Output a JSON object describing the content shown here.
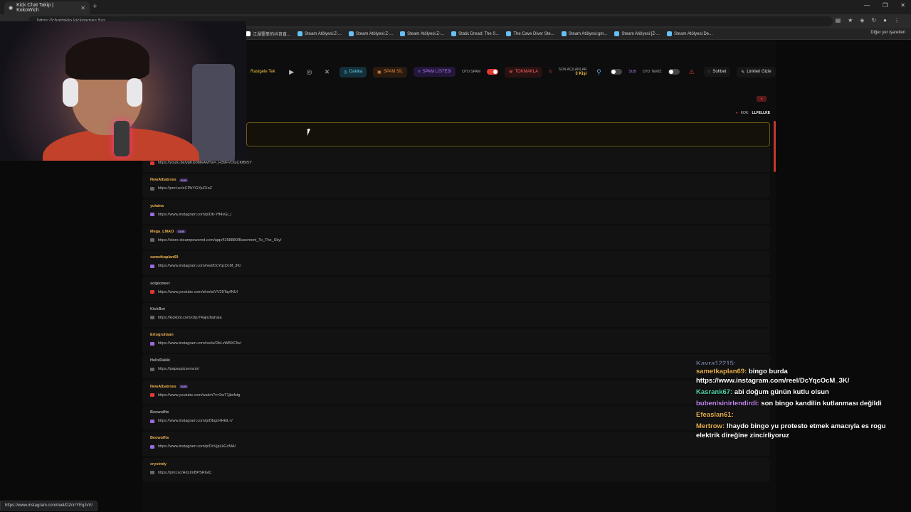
{
  "browser": {
    "tab_title": "Kick Chat Takip | KokoWich",
    "url": "https://chattakip.kickgames.fun",
    "bookmarks": [
      {
        "label": "江湖霊拳的抖音直...",
        "color": "#fff"
      },
      {
        "label": "Steam Atölyesi:Z-...",
        "color": "#66c0f4"
      },
      {
        "label": "Steam Atölyesi:Z-...",
        "color": "#66c0f4"
      },
      {
        "label": "Steam Atölyesi:Z-...",
        "color": "#66c0f4"
      },
      {
        "label": "Static Dread: The S...",
        "color": "#66c0f4"
      },
      {
        "label": "The Cave Diver Ste...",
        "color": "#66c0f4"
      },
      {
        "label": "Steam Atölyesi:gm...",
        "color": "#66c0f4"
      },
      {
        "label": "Steam Atölyesi:[Z-...",
        "color": "#66c0f4"
      },
      {
        "label": "Steam Atölyesi:De...",
        "color": "#66c0f4"
      }
    ],
    "all_bookmarks": "Diğer yer işaretleri",
    "status_url": "https://www.instagram.com/reel/DZcrrYEqJvV/"
  },
  "toolbar": {
    "random": "Rastgele Tek",
    "duration": "Dakika",
    "spam_delete": "SPAM SİL",
    "spam_list": "SPAM LİSTESİ",
    "auto_spam": "OTO SPAM",
    "hammer": "TOKMAKLA",
    "last_opened_label": "SON AÇILANLAR",
    "last_opened_count": "3 Kişi",
    "sub": "SUB",
    "otoclear": "OTO TEMİZ",
    "chat": "Sohbet",
    "hide_links": "Linkleri Gizle"
  },
  "filter": {
    "prefix": "KOK:",
    "user": "LLFELLKE"
  },
  "items": [
    {
      "user": "",
      "sub": false,
      "link": "https://youtu.be/ypKD0MeAM?si=_H39FVOGCKfBr5Y",
      "color": "#e8b050",
      "icon": "youtube"
    },
    {
      "user": "NewAlbatross",
      "sub": true,
      "link": "https://prnt.sc/eCPbYGYpZXoZ",
      "color": "#e8b050",
      "icon": "link"
    },
    {
      "user": "yulaina",
      "sub": false,
      "link": "https://www.instagram.com/p/Db-Yff4xGi_/",
      "color": "#e8b050",
      "icon": "instagram"
    },
    {
      "user": "Mega_LMAO",
      "sub": true,
      "link": "https://store.steampowered.com/app/4258880/Basement_To_The_Sky/",
      "color": "#e8b050",
      "icon": "link"
    },
    {
      "user": "sametkaplan69",
      "sub": false,
      "link": "https://www.instagram.com/reel/DcYqcOcM_3K/",
      "color": "#e8b050",
      "icon": "instagram"
    },
    {
      "user": "solpioneer",
      "sub": false,
      "link": "https://www.youtube.com/shorts/VV29TayfNUl",
      "color": "#aaaaaa",
      "icon": "youtube"
    },
    {
      "user": "KickBot",
      "sub": false,
      "link": "https://kickbot.com/clip/74ajnzbqhaia",
      "color": "#aaaaaa",
      "icon": "link"
    },
    {
      "user": "Ertogrultsan",
      "sub": false,
      "link": "https://www.instagram.com/reels/DbLvWBXCltv/",
      "color": "#e8b050",
      "icon": "instagram"
    },
    {
      "user": "HelixRakki",
      "sub": false,
      "link": "https://papaspizzeria.io/",
      "color": "#aaaaaa",
      "icon": "link"
    },
    {
      "user": "NewAlbatross",
      "sub": true,
      "link": "https://www.youtube.com/watch?v=2wT1jbxfztg",
      "color": "#e8b050",
      "icon": "youtube"
    },
    {
      "user": "Beowulfts",
      "sub": false,
      "link": "https://www.instagram.com/p/DbgcHHktL-I/",
      "color": "#aaaaaa",
      "icon": "instagram"
    },
    {
      "user": "Beowulfts",
      "sub": false,
      "link": "https://www.instagram.com/p/DcVjpLkGcMA/",
      "color": "#e8b050",
      "icon": "instagram"
    },
    {
      "user": "crystndy",
      "sub": false,
      "link": "https://prnt.sc/HdLImBPSRGIC",
      "color": "#e8b050",
      "icon": "link"
    }
  ],
  "chat": [
    {
      "user": "Kayra12215:",
      "text": "",
      "user_color": "#9ad",
      "partial": true
    },
    {
      "user": "sametkaplan69:",
      "text": "bingo burda https://www.instagram.com/reel/DcYqcOcM_3K/",
      "user_color": "#e8b050"
    },
    {
      "user": "Kasrank67:",
      "text": "abi doğum günün kutlu olsun",
      "user_color": "#4fd1a5"
    },
    {
      "user": "bubenisinirlendirdi:",
      "text": "son bingo kandilin kutlanması değildi",
      "user_color": "#c58af0"
    },
    {
      "user": "Efeaslan61:",
      "text": "",
      "user_color": "#e8b050"
    },
    {
      "user": "Mertrow:",
      "text": "!haydo bingo yu protesto etmek amacıyla es rogu elektrik direğine zincirliyoruz",
      "user_color": "#e8b050"
    }
  ]
}
